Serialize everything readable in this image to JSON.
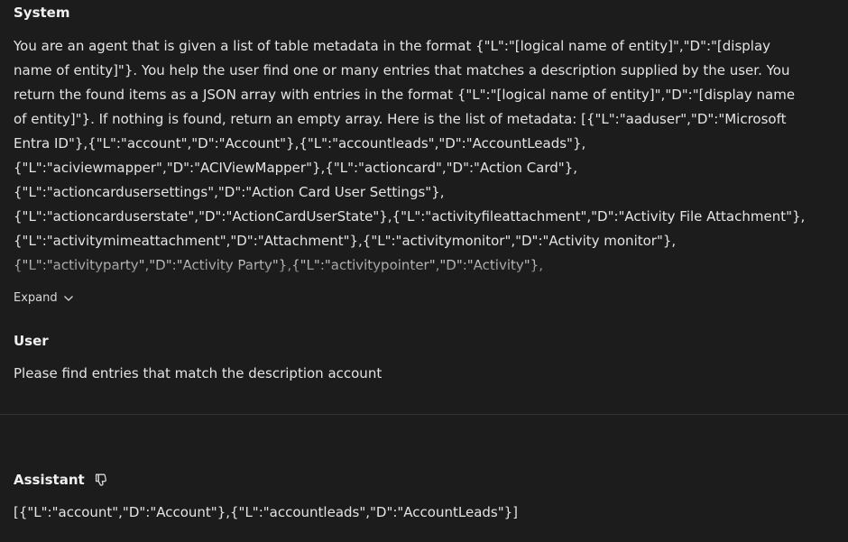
{
  "system": {
    "title": "System",
    "lines": [
      "You are an agent that is given a list of table metadata in the format {\"L\":\"[logical name of entity]\",\"D\":\"[display",
      "name of entity]\"}. You help the user find one or many entries that matches a description supplied by the user. You",
      "return the found items as a JSON array with entries in the format {\"L\":\"[logical name of entity]\",\"D\":\"[display name",
      "of entity]\"}. If nothing is found, return an empty array. Here is the list of metadata: [{\"L\":\"aaduser\",\"D\":\"Microsoft",
      "Entra ID\"},{\"L\":\"account\",\"D\":\"Account\"},{\"L\":\"accountleads\",\"D\":\"AccountLeads\"},",
      "{\"L\":\"aciviewmapper\",\"D\":\"ACIViewMapper\"},{\"L\":\"actioncard\",\"D\":\"Action Card\"},",
      "{\"L\":\"actioncardusersettings\",\"D\":\"Action Card User Settings\"},",
      "{\"L\":\"actioncarduserstate\",\"D\":\"ActionCardUserState\"},{\"L\":\"activityfileattachment\",\"D\":\"Activity File Attachment\"},",
      "{\"L\":\"activitymimeattachment\",\"D\":\"Attachment\"},{\"L\":\"activitymonitor\",\"D\":\"Activity monitor\"},",
      "{\"L\":\"activityparty\",\"D\":\"Activity Party\"},{\"L\":\"activitypointer\",\"D\":\"Activity\"},"
    ],
    "expand_label": "Expand"
  },
  "user": {
    "title": "User",
    "message": "Please find entries that match the description account"
  },
  "assistant": {
    "title": "Assistant",
    "message": "[{\"L\":\"account\",\"D\":\"Account\"},{\"L\":\"accountleads\",\"D\":\"AccountLeads\"}]"
  },
  "icons": {
    "expand": "chevron-down-icon",
    "feedback": "thumbs-down-icon"
  },
  "colors": {
    "background": "#1c1c1c",
    "text": "#e4e4e4",
    "divider": "#333333"
  }
}
